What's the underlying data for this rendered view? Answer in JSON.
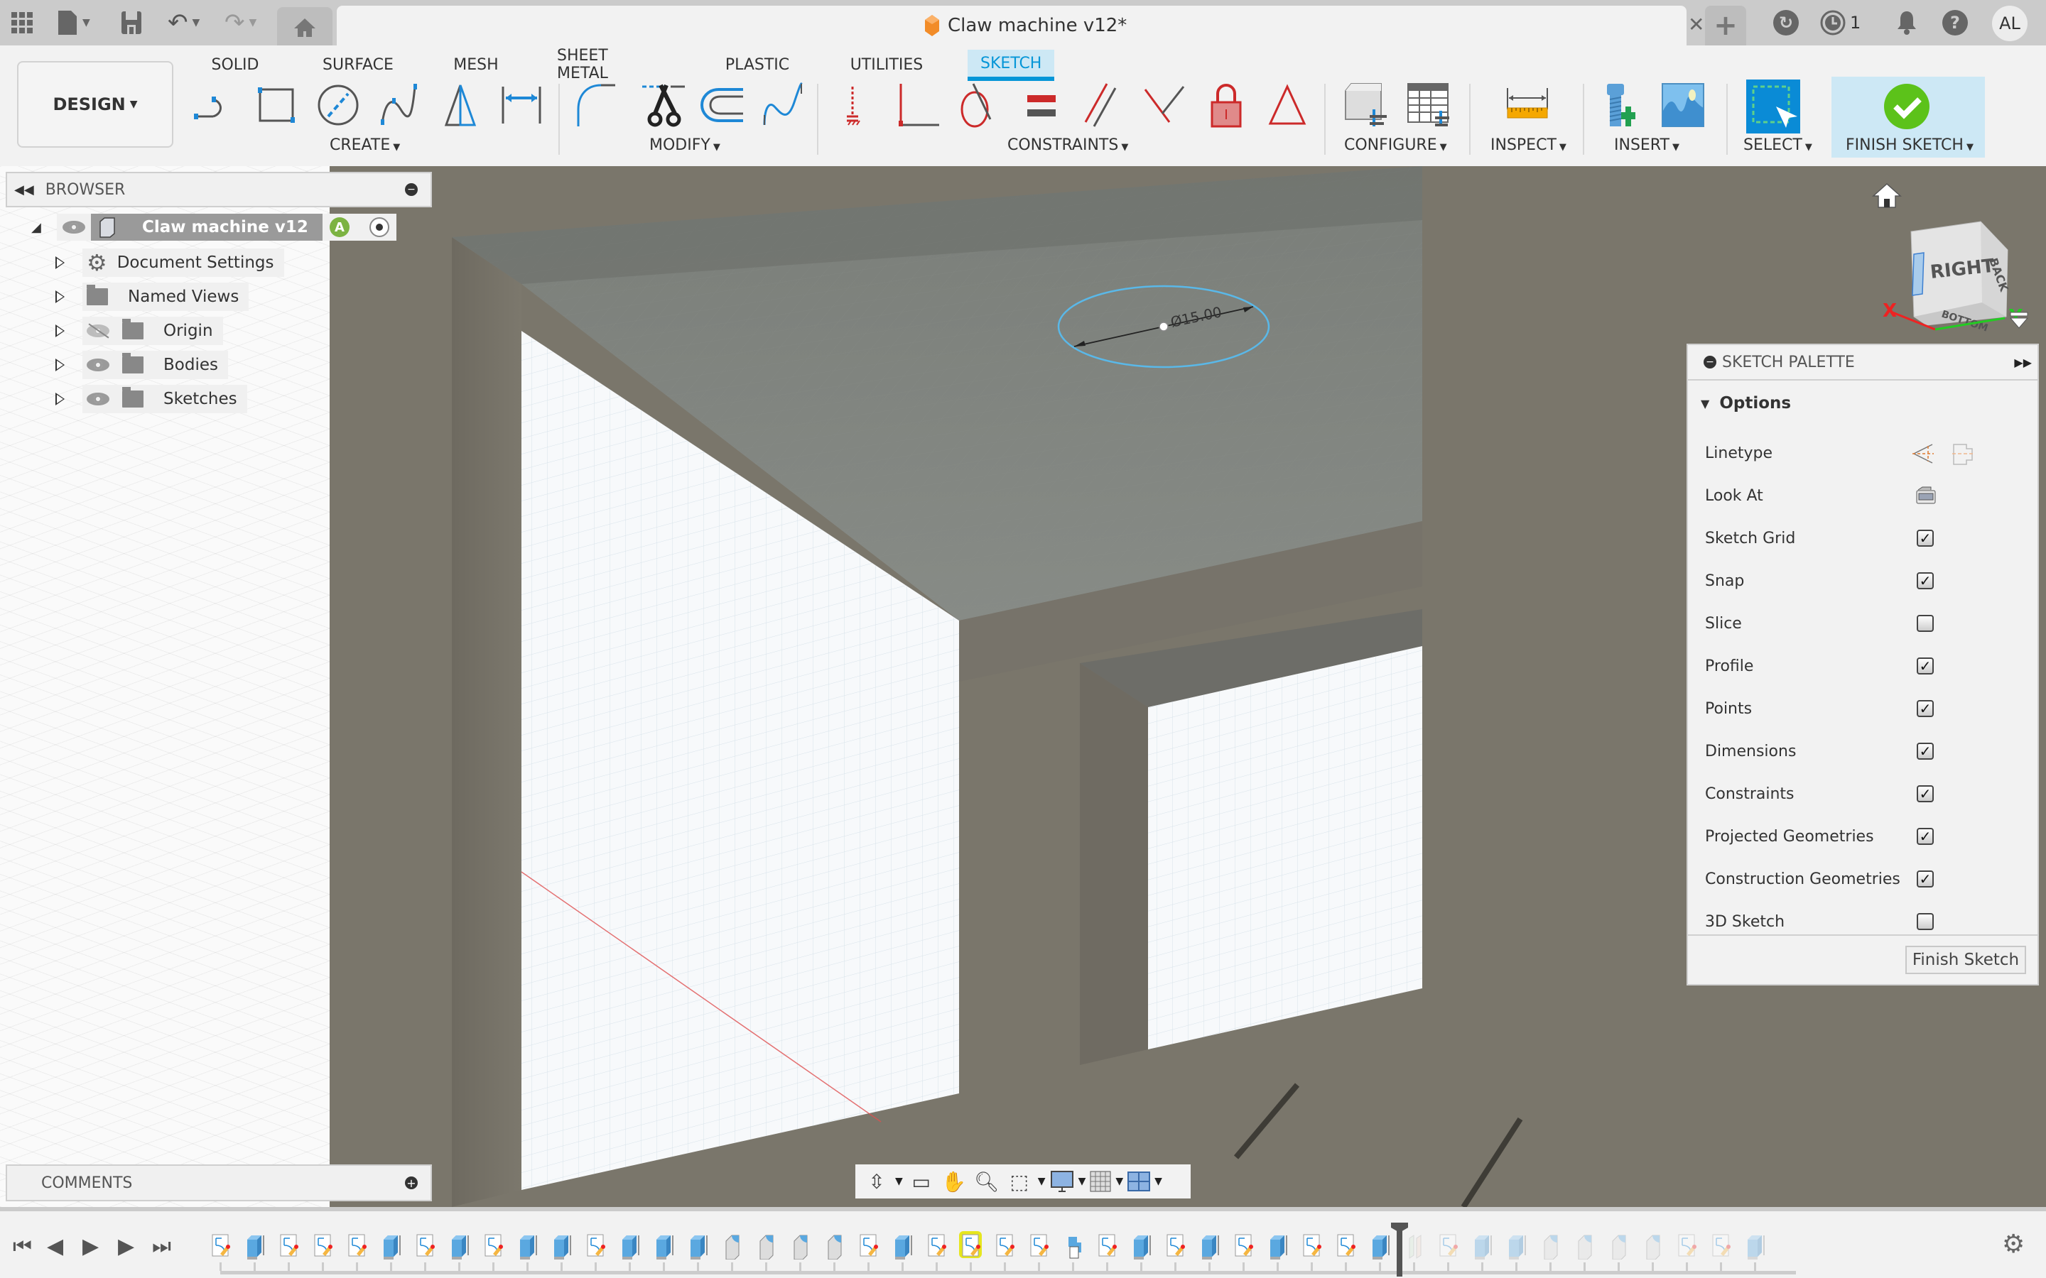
{
  "app": {
    "document_title": "Claw machine v12*",
    "notifications_count": "1",
    "user_initials": "AL",
    "accent_color": "#0696d7",
    "icons": {
      "left": [
        "apps-grid-icon",
        "file-icon",
        "save-icon",
        "undo-icon",
        "redo-icon",
        "home-icon"
      ],
      "right": [
        "new-tab-icon",
        "offline-icon",
        "job-status-icon",
        "notifications-icon",
        "help-icon"
      ]
    }
  },
  "toolbar": {
    "workspace_button": "DESIGN",
    "tabs": [
      {
        "label": "SOLID",
        "active": false
      },
      {
        "label": "SURFACE",
        "active": false
      },
      {
        "label": "MESH",
        "active": false
      },
      {
        "label": "SHEET METAL",
        "active": false
      },
      {
        "label": "PLASTIC",
        "active": false
      },
      {
        "label": "UTILITIES",
        "active": false
      },
      {
        "label": "SKETCH",
        "active": true
      }
    ],
    "groups": [
      {
        "label": "CREATE",
        "tools": [
          "line-icon",
          "rectangle-icon",
          "circle-icon",
          "spline-icon",
          "triangle-mirror-icon",
          "dimension-icon"
        ]
      },
      {
        "label": "MODIFY",
        "tools": [
          "fillet-icon",
          "trim-icon",
          "offset-icon",
          "spline-curve-icon"
        ]
      },
      {
        "label": "CONSTRAINTS",
        "tools": [
          "coincident-icon",
          "perpendicular-icon",
          "tangent-icon",
          "equal-icon",
          "parallel-icon",
          "collinear-icon",
          "fix-lock-icon",
          "triangle-constraint-icon"
        ]
      },
      {
        "label": "CONFIGURE",
        "tools": [
          "configure-model-icon",
          "configure-table-icon"
        ]
      },
      {
        "label": "INSPECT",
        "tools": [
          "measure-icon"
        ]
      },
      {
        "label": "INSERT",
        "tools": [
          "insert-bolt-icon",
          "insert-image-icon"
        ]
      },
      {
        "label": "SELECT",
        "tools": [
          "select-icon"
        ]
      },
      {
        "label": "FINISH SKETCH",
        "tools": [
          "finish-sketch-check-icon"
        ]
      }
    ]
  },
  "browser": {
    "title": "BROWSER",
    "root": {
      "label": "Claw machine v12"
    },
    "items": [
      {
        "label": "Document Settings",
        "icon": "gear-icon",
        "visible_toggle": false
      },
      {
        "label": "Named Views",
        "icon": "folder-icon",
        "visible_toggle": false
      },
      {
        "label": "Origin",
        "icon": "folder-icon",
        "visible_toggle": true,
        "hidden": true
      },
      {
        "label": "Bodies",
        "icon": "folder-icon",
        "visible_toggle": true,
        "hidden": false
      },
      {
        "label": "Sketches",
        "icon": "folder-icon",
        "visible_toggle": true,
        "hidden": false
      }
    ]
  },
  "comments": {
    "title": "COMMENTS"
  },
  "viewport": {
    "dimension_label": "Ø15.00",
    "viewcube": {
      "faces": [
        "RIGHT",
        "BACK",
        "BOTTOM"
      ],
      "axes": [
        "X",
        "Y"
      ]
    }
  },
  "sketch_palette": {
    "title": "SKETCH PALETTE",
    "section": "Options",
    "rows": [
      {
        "label": "Linetype",
        "type": "icons"
      },
      {
        "label": "Look At",
        "type": "button"
      },
      {
        "label": "Sketch Grid",
        "type": "checkbox",
        "checked": true
      },
      {
        "label": "Snap",
        "type": "checkbox",
        "checked": true
      },
      {
        "label": "Slice",
        "type": "checkbox",
        "checked": false
      },
      {
        "label": "Profile",
        "type": "checkbox",
        "checked": true
      },
      {
        "label": "Points",
        "type": "checkbox",
        "checked": true
      },
      {
        "label": "Dimensions",
        "type": "checkbox",
        "checked": true
      },
      {
        "label": "Constraints",
        "type": "checkbox",
        "checked": true
      },
      {
        "label": "Projected Geometries",
        "type": "checkbox",
        "checked": true
      },
      {
        "label": "Construction Geometries",
        "type": "checkbox",
        "checked": true
      },
      {
        "label": "3D Sketch",
        "type": "checkbox",
        "checked": false
      }
    ],
    "finish_button": "Finish Sketch"
  },
  "navbar": {
    "tools": [
      "orbit-icon",
      "look-at-icon",
      "pan-icon",
      "zoom-icon",
      "zoom-window-icon",
      "display-settings-icon",
      "grid-settings-icon",
      "viewports-icon"
    ]
  },
  "timeline": {
    "controls": [
      "first-icon",
      "previous-icon",
      "play-icon",
      "next-icon",
      "last-icon"
    ],
    "features": [
      "sketch",
      "extrude",
      "sketch",
      "sketch",
      "sketch",
      "extrude",
      "sketch",
      "extrude",
      "sketch",
      "extrude",
      "extrude",
      "sketch",
      "extrude",
      "extrude",
      "extrude",
      "fillet",
      "fillet",
      "fillet",
      "fillet",
      "sketch",
      "extrude",
      "sketch",
      "sketch",
      "sketch",
      "sketch",
      "combine",
      "sketch",
      "extrude",
      "sketch",
      "extrude",
      "sketch",
      "extrude",
      "sketch",
      "sketch",
      "extrude",
      "plane",
      "sketch",
      "extrude",
      "extrude",
      "fillet",
      "fillet",
      "fillet",
      "fillet",
      "sketch",
      "sketch",
      "extrude"
    ],
    "highlighted_index": 22,
    "marker_after_index": 34
  }
}
